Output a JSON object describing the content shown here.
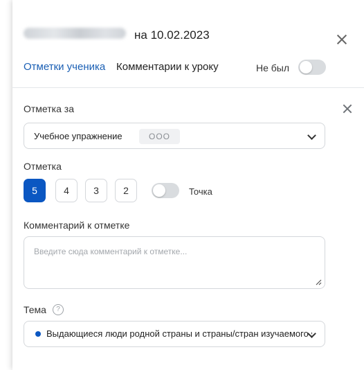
{
  "header": {
    "date_title": "на 10.02.2023",
    "tabs": [
      {
        "label": "Отметки ученика",
        "active": true
      },
      {
        "label": "Комментарии к уроку",
        "active": false
      }
    ],
    "absent_label": "Не был",
    "absent_toggle_on": false
  },
  "form": {
    "mark_for_label": "Отметка за",
    "work_type": "Учебное упражнение",
    "work_code": "ООО",
    "mark_label": "Отметка",
    "grades": [
      "5",
      "4",
      "3",
      "2"
    ],
    "selected_grade": "5",
    "dot_label": "Точка",
    "dot_toggle_on": false,
    "comment_label": "Комментарий к отметке",
    "comment_placeholder": "Введите сюда комментарий к отметке...",
    "topic_label": "Тема",
    "topic_help_icon": "question-circle-icon",
    "topic_value": "Выдающиеся люди родной страны и страны/стран изучаемого языка"
  },
  "colors": {
    "accent": "#0b57c2",
    "tab_active": "#1a5fb4",
    "toggle_off": "#d9dcdf"
  }
}
